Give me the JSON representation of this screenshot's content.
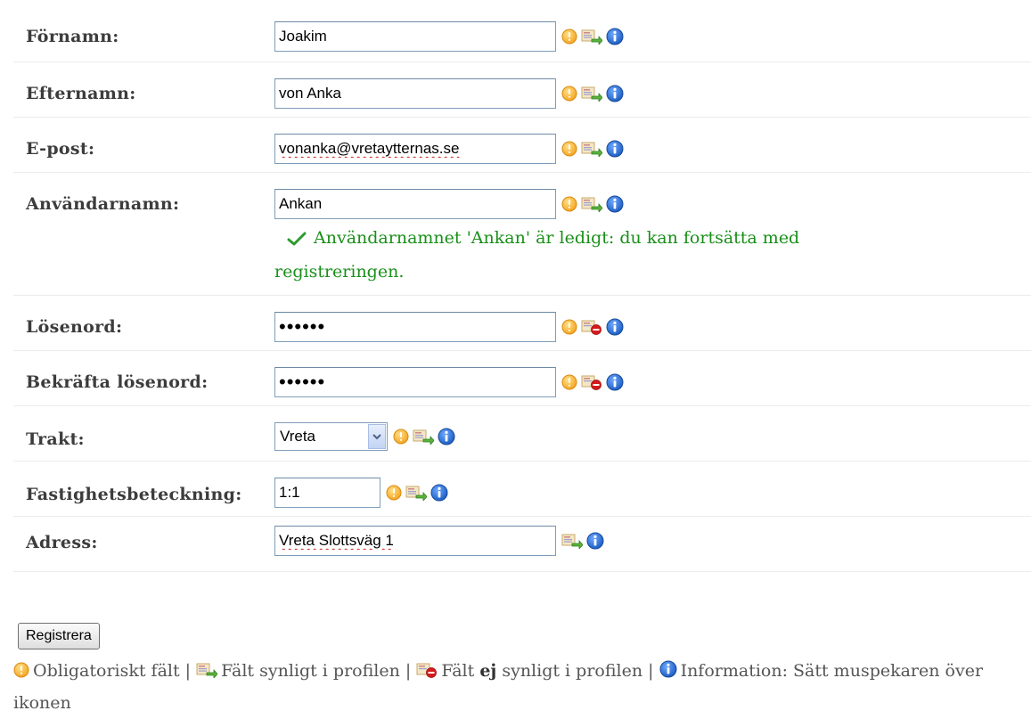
{
  "fields": [
    {
      "id": "fornamn",
      "label": "Förnamn:",
      "value": "Joakim",
      "type": "text",
      "width": "full",
      "icons": [
        "mandatory-icon",
        "visible-in-profile-icon",
        "info-icon"
      ]
    },
    {
      "id": "efternamn",
      "label": "Efternamn:",
      "value": "von Anka",
      "type": "text",
      "width": "full",
      "icons": [
        "mandatory-icon",
        "visible-in-profile-icon",
        "info-icon"
      ]
    },
    {
      "id": "epost",
      "label": "E-post:",
      "value": "vonanka@vretaytternas.se",
      "type": "text",
      "width": "full",
      "icons": [
        "mandatory-icon",
        "visible-in-profile-icon",
        "info-icon"
      ]
    },
    {
      "id": "anvandarnamn",
      "label": "Användarnamn:",
      "value": "Ankan",
      "type": "text",
      "width": "full",
      "icons": [
        "mandatory-icon",
        "visible-in-profile-icon",
        "info-icon"
      ]
    },
    {
      "id": "losenord",
      "label": "Lösenord:",
      "value": "••••••",
      "type": "password",
      "width": "full",
      "icons": [
        "mandatory-icon",
        "hidden-in-profile-icon",
        "info-icon"
      ]
    },
    {
      "id": "bekrafta",
      "label": "Bekräfta lösenord:",
      "value": "••••••",
      "type": "password",
      "width": "full",
      "icons": [
        "mandatory-icon",
        "hidden-in-profile-icon",
        "info-icon"
      ]
    },
    {
      "id": "trakt",
      "label": "Trakt:",
      "value": "Vreta",
      "type": "select",
      "icons": [
        "mandatory-icon",
        "visible-in-profile-icon",
        "info-icon"
      ]
    },
    {
      "id": "fastighet",
      "label": "Fastighetsbeteckning:",
      "value": "1:1",
      "type": "text",
      "width": "short",
      "icons": [
        "mandatory-icon",
        "visible-in-profile-icon",
        "info-icon"
      ]
    },
    {
      "id": "adress",
      "label": "Adress:",
      "value": "Vreta Slottsväg 1",
      "type": "text",
      "width": "full",
      "icons": [
        "visible-in-profile-icon",
        "info-icon"
      ]
    }
  ],
  "username_status": "Användarnamnet 'Ankan' är ledigt: du kan fortsätta med registreringen.",
  "submit_label": "Registrera",
  "legend": {
    "mandatory": "Obligatoriskt fält |",
    "visible": "Fält synligt i profilen |",
    "hidden_pre": "Fält",
    "hidden_bold": "ej",
    "hidden_post": "synligt i profilen |",
    "info": "Information: Sätt muspekaren över ikonen"
  },
  "colors": {
    "success": "#1a8f1a",
    "mandatory": "#f5a623",
    "info": "#1e5fc4",
    "hidden": "#d61b1b",
    "input_border": "#7f9db9"
  }
}
